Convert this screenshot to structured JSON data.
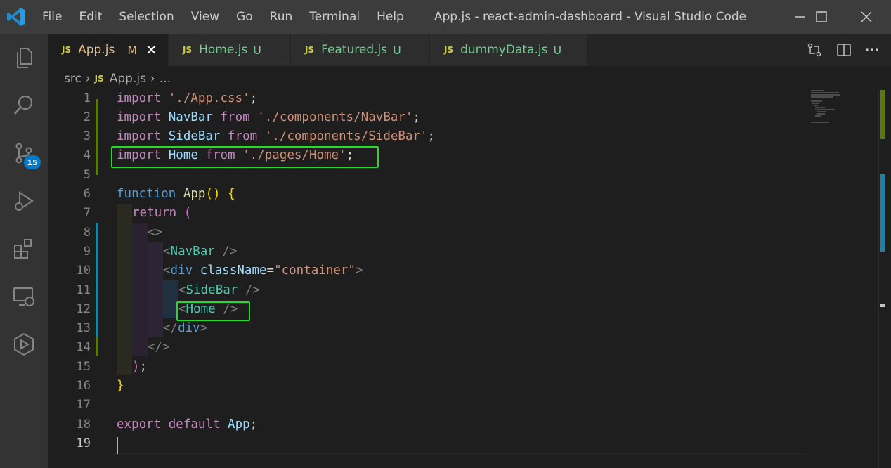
{
  "titlebar": {
    "menu": [
      "File",
      "Edit",
      "Selection",
      "View",
      "Go",
      "Run",
      "Terminal",
      "Help"
    ],
    "window_title": "App.js - react-admin-dashboard - Visual Studio Code"
  },
  "activity_bar": {
    "source_control_badge": "15"
  },
  "tabs": [
    {
      "icon": "JS",
      "name": "App.js",
      "status": "M",
      "active": true
    },
    {
      "icon": "JS",
      "name": "Home.js",
      "status": "U",
      "active": false
    },
    {
      "icon": "JS",
      "name": "Featured.js",
      "status": "U",
      "active": false
    },
    {
      "icon": "JS",
      "name": "dummyData.js",
      "status": "U",
      "active": false
    }
  ],
  "breadcrumb": {
    "folder": "src",
    "icon": "JS",
    "file": "App.js",
    "more": "..."
  },
  "editor": {
    "line_numbers": [
      "1",
      "2",
      "3",
      "4",
      "5",
      "6",
      "7",
      "8",
      "9",
      "10",
      "11",
      "12",
      "13",
      "14",
      "15",
      "16",
      "17",
      "18",
      "19"
    ],
    "current_line": "19",
    "lines": {
      "l1": {
        "a": "import",
        "b": " ",
        "c": "'./App.css'",
        "d": ";"
      },
      "l2": {
        "a": "import",
        "b": " NavBar",
        "c": " from",
        "d": " './components/NavBar'",
        "e": ";"
      },
      "l3": {
        "a": "import",
        "b": " SideBar",
        "c": " from",
        "d": " './components/SideBar'",
        "e": ";"
      },
      "l4": {
        "a": "import",
        "b": " Home",
        "c": " from",
        "d": " './pages/Home'",
        "e": ";"
      },
      "l6": {
        "a": "function",
        "b": " App",
        "c": "()",
        "d": " {"
      },
      "l7": {
        "a": "return",
        "b": " ("
      },
      "l8": {
        "a": "<>"
      },
      "l9": {
        "a": "<",
        "b": "NavBar",
        "c": " />"
      },
      "l10": {
        "a": "<",
        "b": "div",
        "c": " className",
        "d": "=",
        "e": "\"container\"",
        "f": ">"
      },
      "l11": {
        "a": "<",
        "b": "SideBar",
        "c": " />"
      },
      "l12": {
        "a": "<",
        "b": "Home",
        "c": " />"
      },
      "l13": {
        "a": "</",
        "b": "div",
        "c": ">"
      },
      "l14": {
        "a": "</>"
      },
      "l15": {
        "a": ")",
        "b": ";"
      },
      "l16": {
        "a": "}"
      },
      "l18": {
        "a": "export",
        "b": " default",
        "c": " App",
        "d": ";"
      }
    }
  },
  "highlight_color": "#22dd22"
}
